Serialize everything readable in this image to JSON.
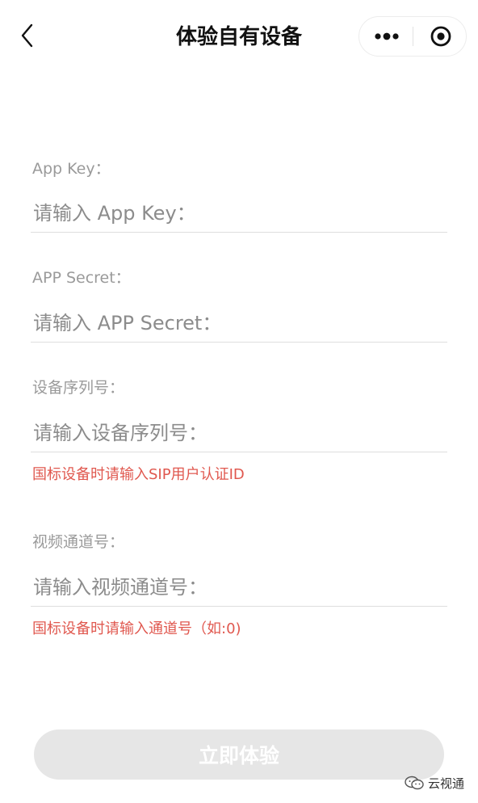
{
  "nav": {
    "title": "体验自有设备",
    "back_icon": "chevron-left-icon",
    "more_icon": "more-dots-icon",
    "close_icon": "target-close-icon"
  },
  "form": {
    "fields": [
      {
        "label": "App Key：",
        "placeholder": "请输入 App Key：",
        "value": ""
      },
      {
        "label": "APP Secret：",
        "placeholder": "请输入 APP Secret：",
        "value": ""
      },
      {
        "label": "设备序列号：",
        "placeholder": "请输入设备序列号：",
        "value": "",
        "hint": "国标设备时请输入SIP用户认证ID"
      },
      {
        "label": "视频通道号：",
        "placeholder": "请输入视频通道号：",
        "value": "",
        "hint": "国标设备时请输入通道号（如:0)"
      }
    ]
  },
  "submit": {
    "label": "立即体验",
    "disabled": true
  },
  "watermark": {
    "text": "云视通",
    "logo": "wechat-logo"
  },
  "colors": {
    "hint": "#e0584f",
    "label": "#9a9a9a",
    "button_disabled_bg": "#e6e6e6",
    "button_text": "#ffffff"
  }
}
